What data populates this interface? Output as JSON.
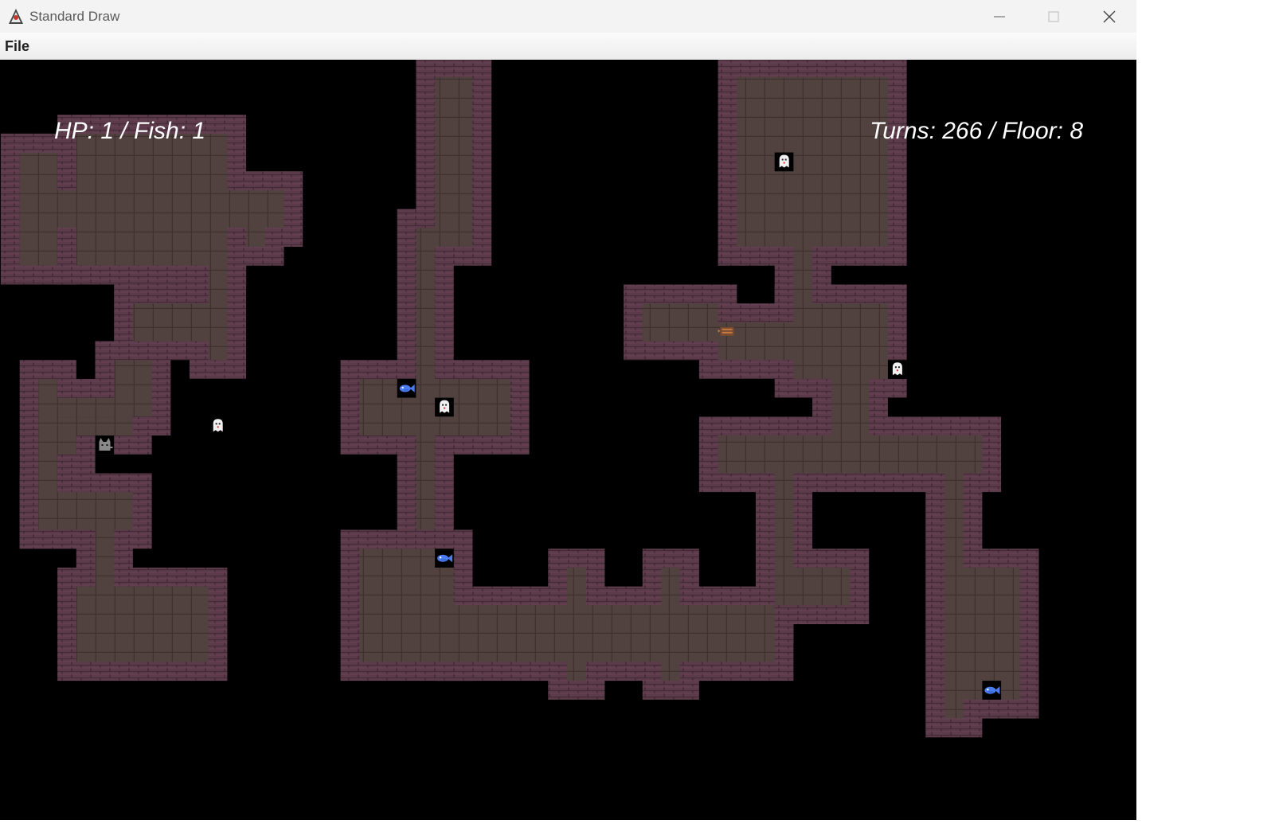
{
  "window": {
    "title": "Standard Draw",
    "app_icon": "java-duke-icon",
    "controls": [
      "minimize-icon",
      "maximize-icon",
      "close-icon"
    ]
  },
  "menubar": {
    "items": [
      {
        "label": "File"
      }
    ]
  },
  "hud": {
    "stats_left": "HP: 1 / Fish: 1",
    "stats_right": "Turns: 266 / Floor: 8"
  },
  "game": {
    "colors": {
      "background": "#000000",
      "wall": "#5b3b4a",
      "floor": "#4b3d3a",
      "fish": "#4a7cf0",
      "ghost": "#f0f0f0"
    },
    "sprites": [
      {
        "kind": "ghost",
        "name": "ghost-icon"
      },
      {
        "kind": "ghost",
        "name": "ghost-icon"
      },
      {
        "kind": "ghost",
        "name": "ghost-icon"
      },
      {
        "kind": "ghost",
        "name": "ghost-icon"
      },
      {
        "kind": "fish",
        "name": "fish-icon"
      },
      {
        "kind": "fish",
        "name": "fish-icon"
      },
      {
        "kind": "fish",
        "name": "fish-icon"
      },
      {
        "kind": "cat",
        "name": "cat-player-icon"
      },
      {
        "kind": "stairs",
        "name": "stairs-icon"
      }
    ]
  }
}
